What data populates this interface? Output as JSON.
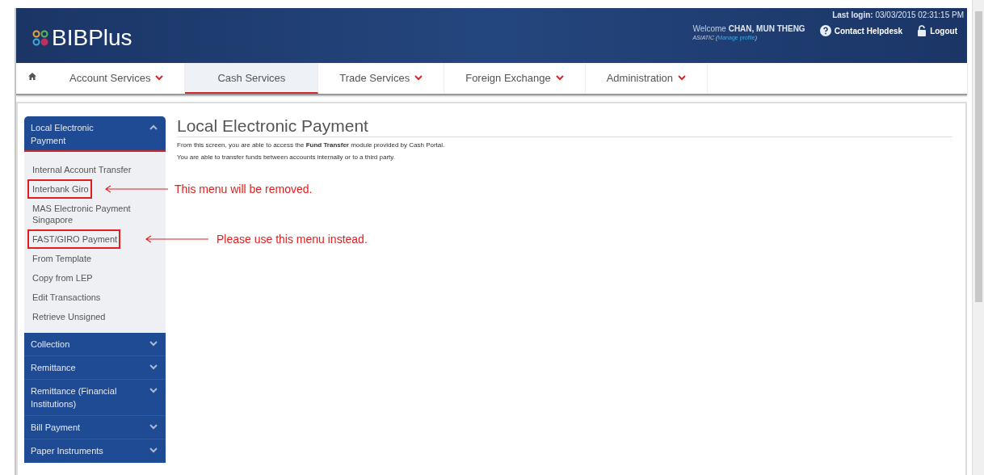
{
  "header": {
    "logo": "BIBPlus",
    "last_login_label": "Last login:",
    "last_login_value": "03/03/2015 02:31:15 PM",
    "welcome_label": "Welcome",
    "user_name": "CHAN, MUN THENG",
    "company": "ASIATIC",
    "profile_open": "(",
    "profile_link": "Manage profile",
    "profile_close": ")",
    "helpdesk": "Contact Helpdesk",
    "logout": "Logout"
  },
  "nav": [
    {
      "label": "Account Services",
      "dropdown": true,
      "selected": false
    },
    {
      "label": "Cash Services",
      "dropdown": false,
      "selected": true
    },
    {
      "label": "Trade Services",
      "dropdown": true,
      "selected": false
    },
    {
      "label": "Foreign Exchange",
      "dropdown": true,
      "selected": false
    },
    {
      "label": "Administration",
      "dropdown": true,
      "selected": false
    }
  ],
  "sidebar": [
    {
      "title": "Local Electronic Payment",
      "expanded": true,
      "items": [
        {
          "label": "Internal Account Transfer",
          "marked": false
        },
        {
          "label": "Interbank Giro",
          "marked": true,
          "note": "This menu will be removed."
        },
        {
          "label": "MAS Electronic Payment Singapore",
          "marked": false
        },
        {
          "label": "FAST/GIRO Payment",
          "marked": true,
          "note": "Please use this menu instead."
        },
        {
          "label": "From Template",
          "marked": false
        },
        {
          "label": "Copy from LEP",
          "marked": false
        },
        {
          "label": "Edit Transactions",
          "marked": false
        },
        {
          "label": "Retrieve Unsigned",
          "marked": false
        }
      ]
    },
    {
      "title": "Collection",
      "expanded": false
    },
    {
      "title": "Remittance",
      "expanded": false
    },
    {
      "title": "Remittance (Financial Institutions)",
      "expanded": false
    },
    {
      "title": "Bill Payment",
      "expanded": false
    },
    {
      "title": "Paper Instruments",
      "expanded": false
    }
  ],
  "main": {
    "title": "Local Electronic Payment",
    "paragraphs": [
      "From this screen, you are able to access the **Fund Transfer** module provided by Cash Portal.",
      "You are able to transfer funds between accounts internally or to a third party."
    ]
  }
}
